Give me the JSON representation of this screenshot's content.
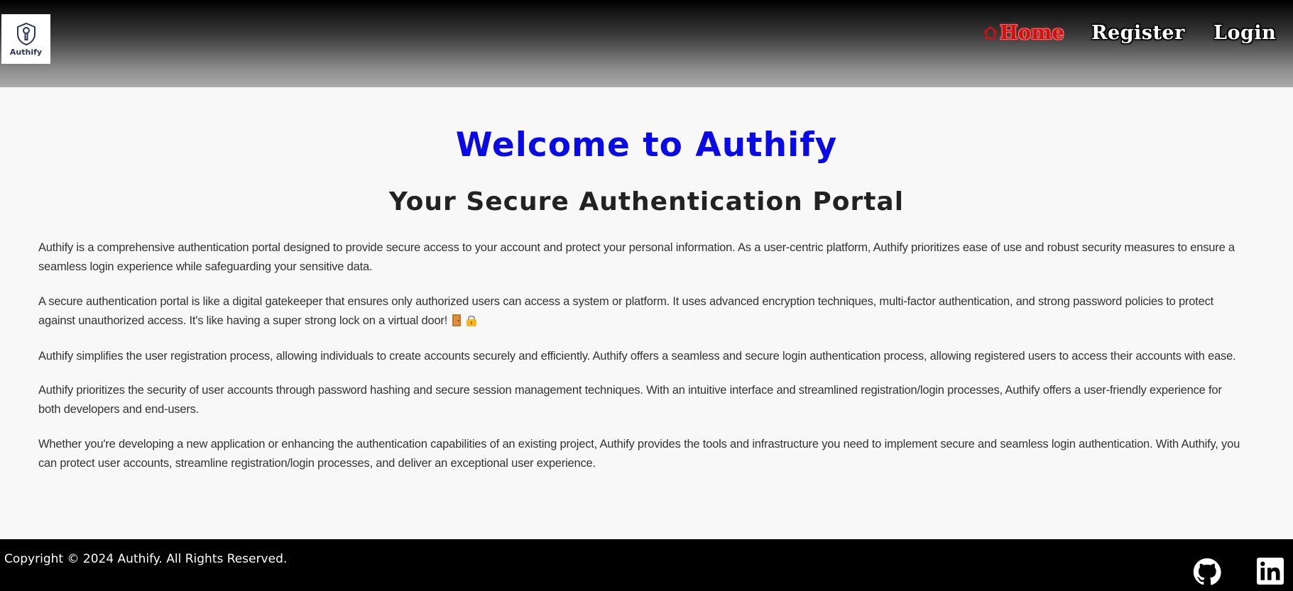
{
  "header": {
    "logo_text": "Authify",
    "nav": {
      "home": "Home",
      "register": "Register",
      "login": "Login"
    }
  },
  "main": {
    "title": "Welcome to Authify",
    "subtitle": "Your Secure Authentication Portal",
    "paragraphs": [
      "Authify is a comprehensive authentication portal designed to provide secure access to your account and protect your personal information. As a user-centric platform, Authify prioritizes ease of use and robust security measures to ensure a seamless login experience while safeguarding your sensitive data.",
      "A secure authentication portal is like a digital gatekeeper that ensures only authorized users can access a system or platform. It uses advanced encryption techniques, multi-factor authentication, and strong password policies to protect against unauthorized access. It's like having a super strong lock on a virtual door!",
      "Authify simplifies the user registration process, allowing individuals to create accounts securely and efficiently. Authify offers a seamless and secure login authentication process, allowing registered users to access their accounts with ease.",
      "Authify prioritizes the security of user accounts through password hashing and secure session management techniques. With an intuitive interface and streamlined registration/login processes, Authify offers a user-friendly experience for both developers and end-users.",
      "Whether you're developing a new application or enhancing the authentication capabilities of an existing project, Authify provides the tools and infrastructure you need to implement secure and seamless login authentication. With Authify, you can protect user accounts, streamline registration/login processes, and deliver an exceptional user experience."
    ]
  },
  "footer": {
    "copyright": "Copyright © 2024 Authify. All Rights Reserved.",
    "social": [
      "github-icon",
      "linkedin-icon"
    ]
  },
  "colors": {
    "title": "#0a0ae6",
    "nav_active": "#c81414",
    "footer_bg": "#000000"
  }
}
